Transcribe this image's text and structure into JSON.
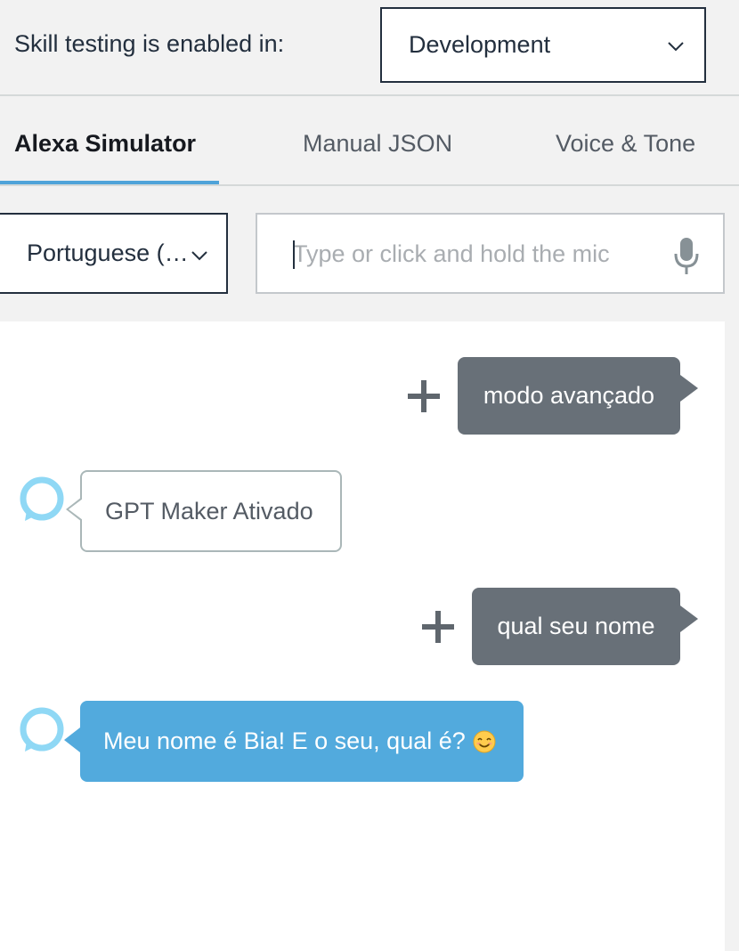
{
  "header": {
    "label": "Skill testing is enabled in:",
    "stage_value": "Development"
  },
  "tabs": [
    {
      "label": "Alexa Simulator",
      "active": true
    },
    {
      "label": "Manual JSON",
      "active": false
    },
    {
      "label": "Voice & Tone",
      "active": false
    }
  ],
  "locale": {
    "value": "Portuguese (…"
  },
  "utterance": {
    "value": "",
    "placeholder": "Type or click and hold the mic"
  },
  "conversation": [
    {
      "role": "user",
      "text": "modo avançado"
    },
    {
      "role": "alexa",
      "text": "GPT Maker Ativado",
      "style": "outline"
    },
    {
      "role": "user",
      "text": "qual seu nome"
    },
    {
      "role": "alexa",
      "text": "Meu nome é Bia! E o seu, qual é?",
      "style": "filled",
      "emoji": "smiling-face-emoji"
    }
  ],
  "colors": {
    "user_bubble": "#687078",
    "alexa_filled_bubble": "#52aadd",
    "alexa_ring": "#8fd8f5",
    "tab_underline": "#4fa3d9"
  },
  "icons": [
    "chevron-down-icon",
    "microphone-icon",
    "plus-icon",
    "alexa-ring-icon",
    "smiling-face-emoji"
  ]
}
